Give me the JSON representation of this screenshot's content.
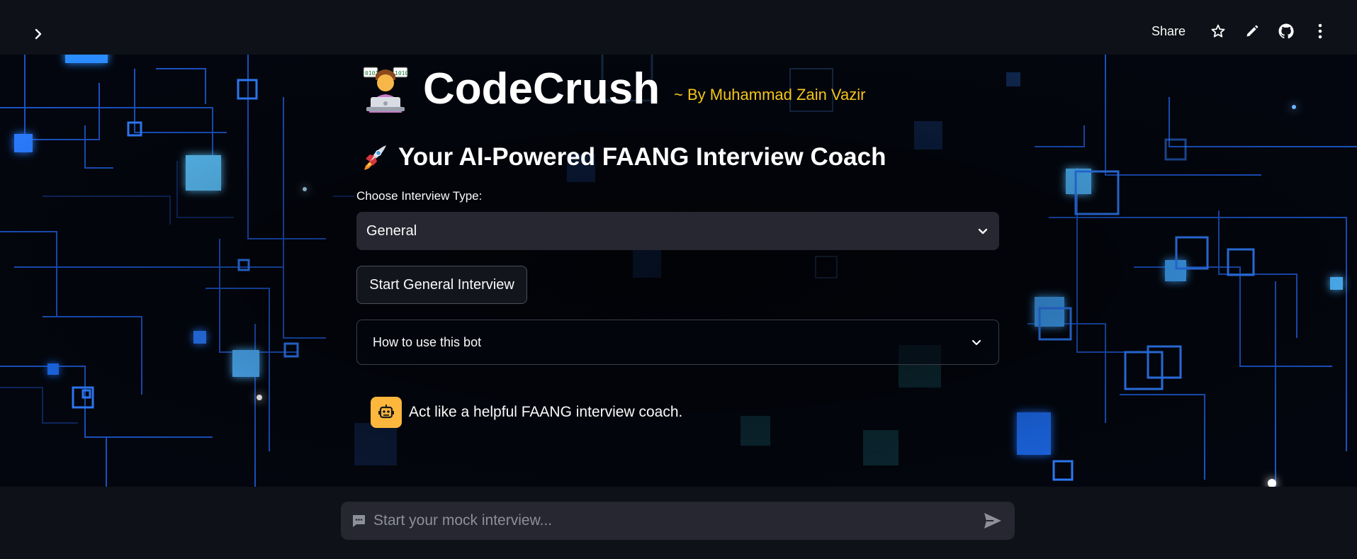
{
  "header": {
    "share_label": "Share",
    "icons": [
      "chevron-right-icon",
      "star-icon",
      "pencil-icon",
      "github-icon",
      "more-vertical-icon"
    ]
  },
  "app": {
    "title": "CodeCrush",
    "title_emoji": "technologist-emoji",
    "byline": "~ By Muhammad Zain Vazir",
    "subtitle": "Your AI-Powered FAANG Interview Coach",
    "subtitle_emoji": "rocket-emoji"
  },
  "interview_select": {
    "label": "Choose Interview Type:",
    "value": "General"
  },
  "start_button": {
    "label": "Start General Interview"
  },
  "expander": {
    "label": "How to use this bot"
  },
  "chat": {
    "messages": [
      {
        "role": "assistant",
        "avatar": "robot-icon",
        "text": "Act like a helpful FAANG interview coach."
      }
    ],
    "input_placeholder": "Start your mock interview..."
  },
  "colors": {
    "background": "#0e1117",
    "widget": "#262730",
    "accent_byline": "#f5c518",
    "avatar": "#fcb73c",
    "circuit_blue": "#1f6bff"
  }
}
